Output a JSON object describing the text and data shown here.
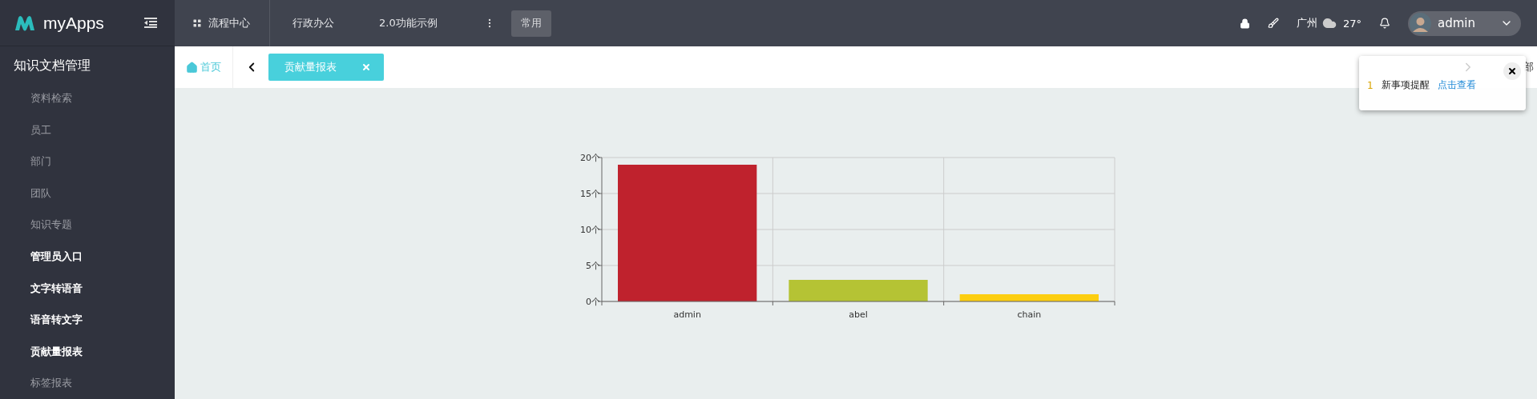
{
  "brand": {
    "name": "myApps"
  },
  "top_nav": [
    {
      "label": "流程中心",
      "kind": "grid"
    },
    {
      "label": "行政办公",
      "kind": "plain"
    },
    {
      "label": "2.0功能示例",
      "kind": "plain"
    }
  ],
  "favorites_button": "常用",
  "weather": {
    "city": "广州",
    "temperature": "27°"
  },
  "user": {
    "name": "admin"
  },
  "sidebar": {
    "title": "知识文档管理",
    "items": [
      {
        "label": "资料检索",
        "highlighted": false
      },
      {
        "label": "员工",
        "highlighted": false
      },
      {
        "label": "部门",
        "highlighted": false
      },
      {
        "label": "团队",
        "highlighted": false
      },
      {
        "label": "知识专题",
        "highlighted": false
      },
      {
        "label": "管理员入口",
        "highlighted": true
      },
      {
        "label": "文字转语音",
        "highlighted": true
      },
      {
        "label": "语音转文字",
        "highlighted": true
      },
      {
        "label": "贡献量报表",
        "highlighted": true
      },
      {
        "label": "标签报表",
        "highlighted": false
      }
    ]
  },
  "home_tab": "首页",
  "tabs": [
    {
      "label": "贡献量报表",
      "selected": true
    }
  ],
  "close_all": "部",
  "notification": {
    "count": "1",
    "text": "新事项提醒",
    "link": "点击查看"
  },
  "chart_data": {
    "type": "bar",
    "grid": true,
    "categories": [
      "admin",
      "abel",
      "chain"
    ],
    "values": [
      19,
      3,
      1
    ],
    "colors": [
      "#bf222d",
      "#b5c334",
      "#fcce10"
    ],
    "ylim": [
      0,
      20
    ],
    "yticks": [
      {
        "value": 0,
        "label": "0个"
      },
      {
        "value": 5,
        "label": "5个"
      },
      {
        "value": 10,
        "label": "10个"
      },
      {
        "value": 15,
        "label": "15个"
      },
      {
        "value": 20,
        "label": "20个"
      }
    ]
  }
}
